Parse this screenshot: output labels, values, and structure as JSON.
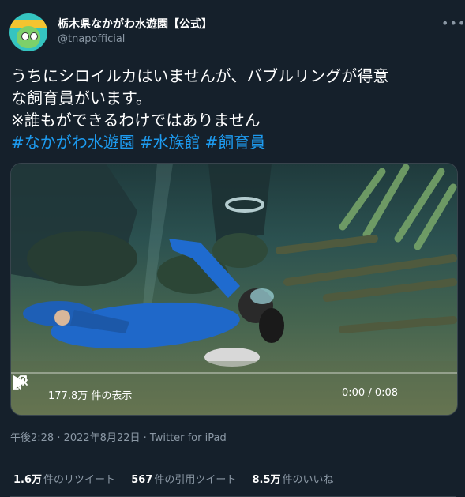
{
  "account": {
    "name": "栃木県なかがわ水遊園【公式】",
    "handle": "@tnapofficial"
  },
  "tweet": {
    "text": "うちにシロイルカはいませんが、バブルリングが得意\nな飼育員がいます。\n※誰もができるわけではありません",
    "hashtags": [
      "#なかがわ水遊園",
      "#水族館",
      "#飼育員"
    ]
  },
  "video": {
    "views": "177.8万 件の表示",
    "time": "0:00 / 0:08",
    "progress": 0
  },
  "meta": {
    "timestamp": "午後2:28 · 2022年8月22日",
    "separator": " · ",
    "client": "Twitter for iPad"
  },
  "stats": [
    {
      "count": "1.6万",
      "label": "件のリツイート"
    },
    {
      "count": "567",
      "label": "件の引用ツイート"
    },
    {
      "count": "8.5万",
      "label": "件のいいね"
    }
  ],
  "icons": {
    "more": "more-dots-icon",
    "play": "play-icon",
    "volume": "volume-muted-icon",
    "fullscreen": "fullscreen-icon"
  },
  "colors": {
    "background": "#15202b",
    "link": "#1d9bf0",
    "secondary": "#8b98a5",
    "divider": "#38444d"
  }
}
